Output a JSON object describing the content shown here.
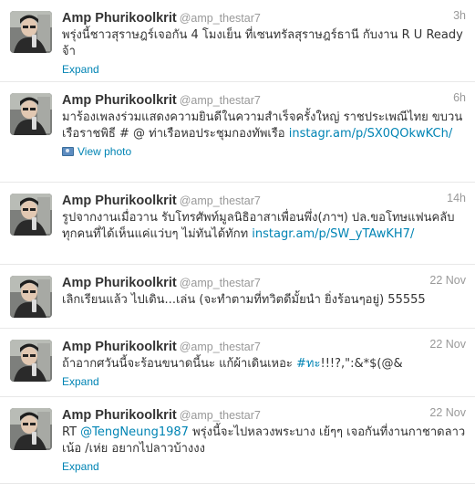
{
  "tweets": [
    {
      "name": "Amp Phurikoolkrit",
      "handle": "@amp_thestar7",
      "time": "3h",
      "segments": [
        {
          "text": "พรุ่งนี้ชาวสุราษฎร์เจอกัน 4 โมงเย็น ที่เซนทรัลสุราษฎร์ธานี กับงาน R U Ready จ้า",
          "link": false
        }
      ],
      "action": "Expand"
    },
    {
      "name": "Amp Phurikoolkrit",
      "handle": "@amp_thestar7",
      "time": "6h",
      "segments": [
        {
          "text": "มาร้องเพลงร่วมแสดงความยินดีในความสำเร็จครั้งใหญ่ ราชประเพณีไทย ขบวนเรือราชพิธี # @ ท่าเรือหอประชุมกองทัพเรือ ",
          "link": false
        },
        {
          "text": "instagr.am/p/SX0QOkwKCh/",
          "link": true
        }
      ],
      "action": "View photo"
    },
    {
      "name": "Amp Phurikoolkrit",
      "handle": "@amp_thestar7",
      "time": "14h",
      "segments": [
        {
          "text": "รูปจากงานเมื่อวาน รับโทรศัพท์มูลนิธิอาสาเพื่อนพึ่ง(ภาฯ) ปล.ขอโทษแฟนคลับทุกคนที่ได้เห็นแค่แว่บๆ ไม่ทันได้ทักท ",
          "link": false
        },
        {
          "text": "instagr.am/p/SW_yTAwKH7/",
          "link": true
        }
      ],
      "action": ""
    },
    {
      "name": "Amp Phurikoolkrit",
      "handle": "@amp_thestar7",
      "time": "22 Nov",
      "segments": [
        {
          "text": "เลิกเรียนแล้ว ไปเดิน...เล่น (จะทำตามที่ทวิตดีมั้ยนำ ยิ่งร้อนๆอยู่) 55555",
          "link": false
        }
      ],
      "action": ""
    },
    {
      "name": "Amp Phurikoolkrit",
      "handle": "@amp_thestar7",
      "time": "22 Nov",
      "segments": [
        {
          "text": "ถ้าอากศวันนี้จะร้อนขนาดนี้นะ แก้ผ้าเดินเหอะ ",
          "link": false
        },
        {
          "text": "#ทะ",
          "link": true
        },
        {
          "text": "!!!?,\":&*$(@&",
          "link": false
        }
      ],
      "action": "Expand"
    },
    {
      "name": "Amp Phurikoolkrit",
      "handle": "@amp_thestar7",
      "time": "22 Nov",
      "segments": [
        {
          "text": "RT ",
          "link": false
        },
        {
          "text": "@TengNeung1987",
          "link": true
        },
        {
          "text": " พรุ่งนี้จะไปหลวงพระบาง เย้ๆๆ เจอกันที่งานกาชาดลาว เน้อ /เห่ย อยากไปลาวบ้างงง",
          "link": false
        }
      ],
      "action": "Expand"
    }
  ]
}
